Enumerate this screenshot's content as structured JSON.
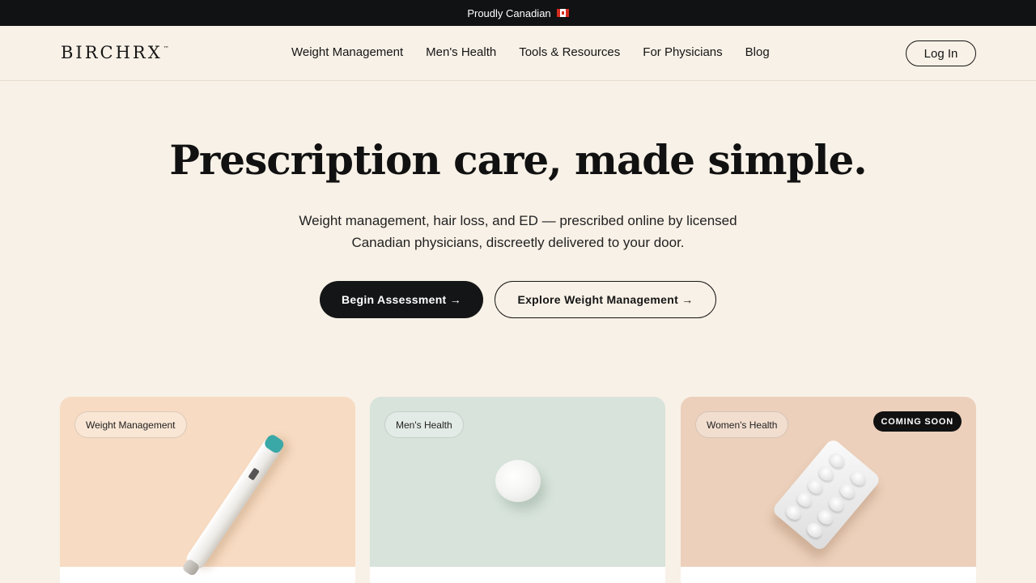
{
  "announcement": {
    "text": "Proudly Canadian"
  },
  "header": {
    "logo": "BIRCHRX",
    "logo_tm": "™",
    "nav": [
      "Weight Management",
      "Men's Health",
      "Tools & Resources",
      "For Physicians",
      "Blog"
    ],
    "login_label": "Log In"
  },
  "hero": {
    "title": "Prescription care, made simple.",
    "subtitle_line1": "Weight management, hair loss, and ED — prescribed online by licensed",
    "subtitle_line2": "Canadian physicians, discreetly delivered to your door.",
    "primary_cta": "Begin Assessment →",
    "secondary_cta": "Explore Weight Management →"
  },
  "cards": [
    {
      "tag": "Weight Management",
      "image": "injection-pen",
      "bg": "#f7dbc2"
    },
    {
      "tag": "Men's Health",
      "image": "white-pill",
      "bg": "#d7e3db"
    },
    {
      "tag": "Women's Health",
      "badge": "COMING SOON",
      "image": "blister-pack",
      "bg": "#ecd0bb"
    }
  ]
}
